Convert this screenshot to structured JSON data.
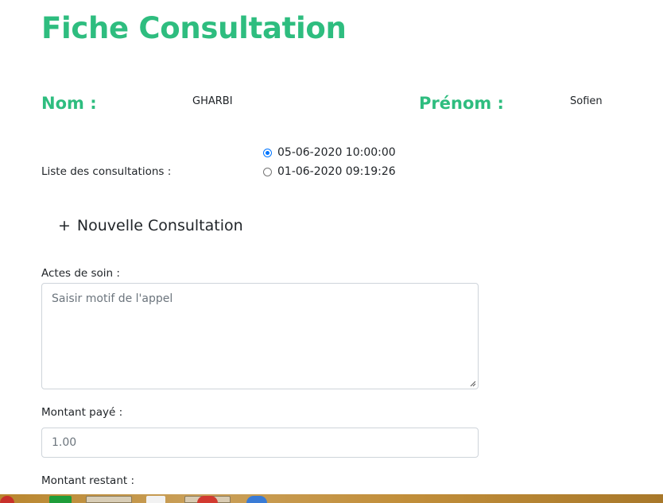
{
  "page": {
    "title": "Fiche Consultation"
  },
  "patient": {
    "nom_label": "Nom :",
    "nom_value": "GHARBI",
    "prenom_label": "Prénom :",
    "prenom_value": "Sofien"
  },
  "consultations": {
    "label": "Liste des consultations :",
    "items": [
      {
        "label": "05-06-2020 10:00:00",
        "checked": true
      },
      {
        "label": "01-06-2020 09:19:26",
        "checked": false
      }
    ]
  },
  "new_consultation": {
    "plus": "+",
    "label": "Nouvelle Consultation"
  },
  "form": {
    "actes_label": "Actes de soin :",
    "actes_placeholder": "Saisir motif de l'appel",
    "montant_paye_label": "Montant payé :",
    "montant_paye_value": "1.00",
    "montant_restant_label": "Montant restant :"
  },
  "colors": {
    "accent": "#2ebd7f",
    "radio": "#0075ff"
  }
}
